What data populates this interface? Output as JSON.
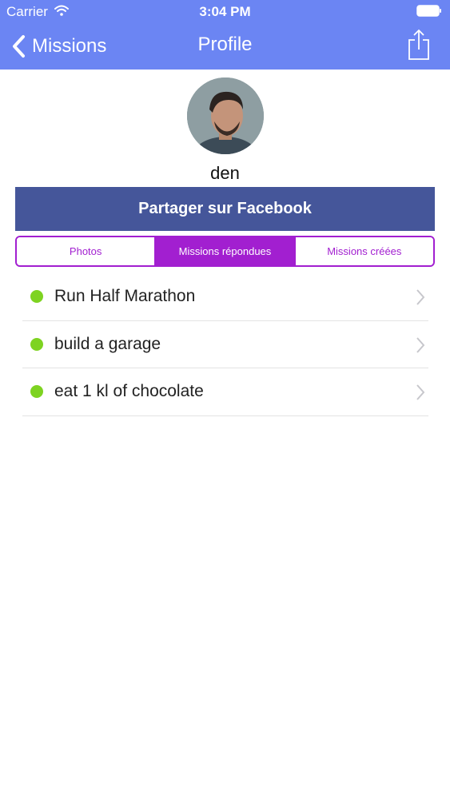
{
  "status_bar": {
    "carrier": "Carrier",
    "time": "3:04 PM"
  },
  "nav": {
    "back_label": "Missions",
    "title": "Profile"
  },
  "profile": {
    "username": "den",
    "facebook_button": "Partager sur Facebook"
  },
  "tabs": [
    {
      "label": "Photos",
      "active": false
    },
    {
      "label": "Missions répondues",
      "active": true
    },
    {
      "label": "Missions créées",
      "active": false
    }
  ],
  "missions": [
    {
      "title": "Run Half Marathon"
    },
    {
      "title": "build a garage"
    },
    {
      "title": "eat 1 kl of chocolate"
    }
  ],
  "colors": {
    "header": "#6b85f3",
    "facebook": "#45569a",
    "accent": "#a21fd0",
    "status_dot": "#7ed321"
  },
  "icons": {
    "wifi": "wifi-icon",
    "battery": "battery-icon",
    "back": "back-chevron-icon",
    "share": "share-icon",
    "row_chevron": "chevron-right-icon"
  }
}
